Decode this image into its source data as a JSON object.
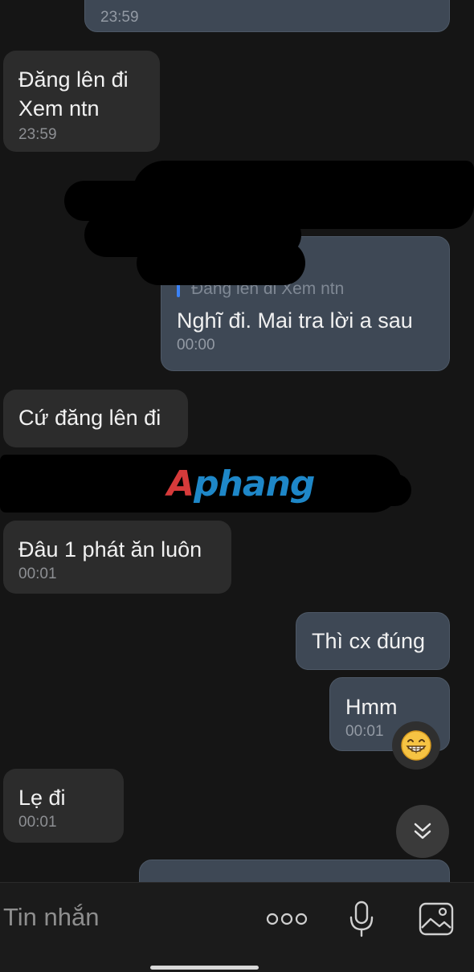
{
  "messages": [
    {
      "id": "m0",
      "direction": "out",
      "text": [],
      "time": "23:59"
    },
    {
      "id": "m1",
      "direction": "in",
      "text": [
        "Đăng lên đi",
        "Xem ntn"
      ],
      "time": "23:59"
    },
    {
      "id": "m2",
      "direction": "out",
      "reply_quote": "Đăng lên đi Xem ntn",
      "text": [
        "Nghĩ đi. Mai tra lời a sau"
      ],
      "time": "00:00"
    },
    {
      "id": "m3",
      "direction": "in",
      "text": [
        "Cứ đăng lên đi"
      ],
      "time": ""
    },
    {
      "id": "m4",
      "direction": "in",
      "text": [
        "Đâu 1 phát ăn luôn"
      ],
      "time": "00:01"
    },
    {
      "id": "m5",
      "direction": "out",
      "text": [
        "Thì cx đúng"
      ],
      "time": ""
    },
    {
      "id": "m6",
      "direction": "out",
      "text": [
        "Hmm"
      ],
      "time": "00:01",
      "reaction": "grinning-face-emoji"
    },
    {
      "id": "m7",
      "direction": "in",
      "text": [
        "Lẹ đi"
      ],
      "time": "00:01"
    }
  ],
  "watermark": {
    "first": "A",
    "rest": "phang"
  },
  "input": {
    "placeholder": "Tin nhắn"
  },
  "icons": {
    "more": "more-dots-icon",
    "mic": "microphone-icon",
    "image": "image-gallery-icon",
    "scroll": "double-chevron-down-icon"
  },
  "colors": {
    "background": "#151515",
    "incoming_bubble": "#2c2c2c",
    "outgoing_bubble": "#3e4855",
    "reply_bar": "#3b82f6"
  }
}
